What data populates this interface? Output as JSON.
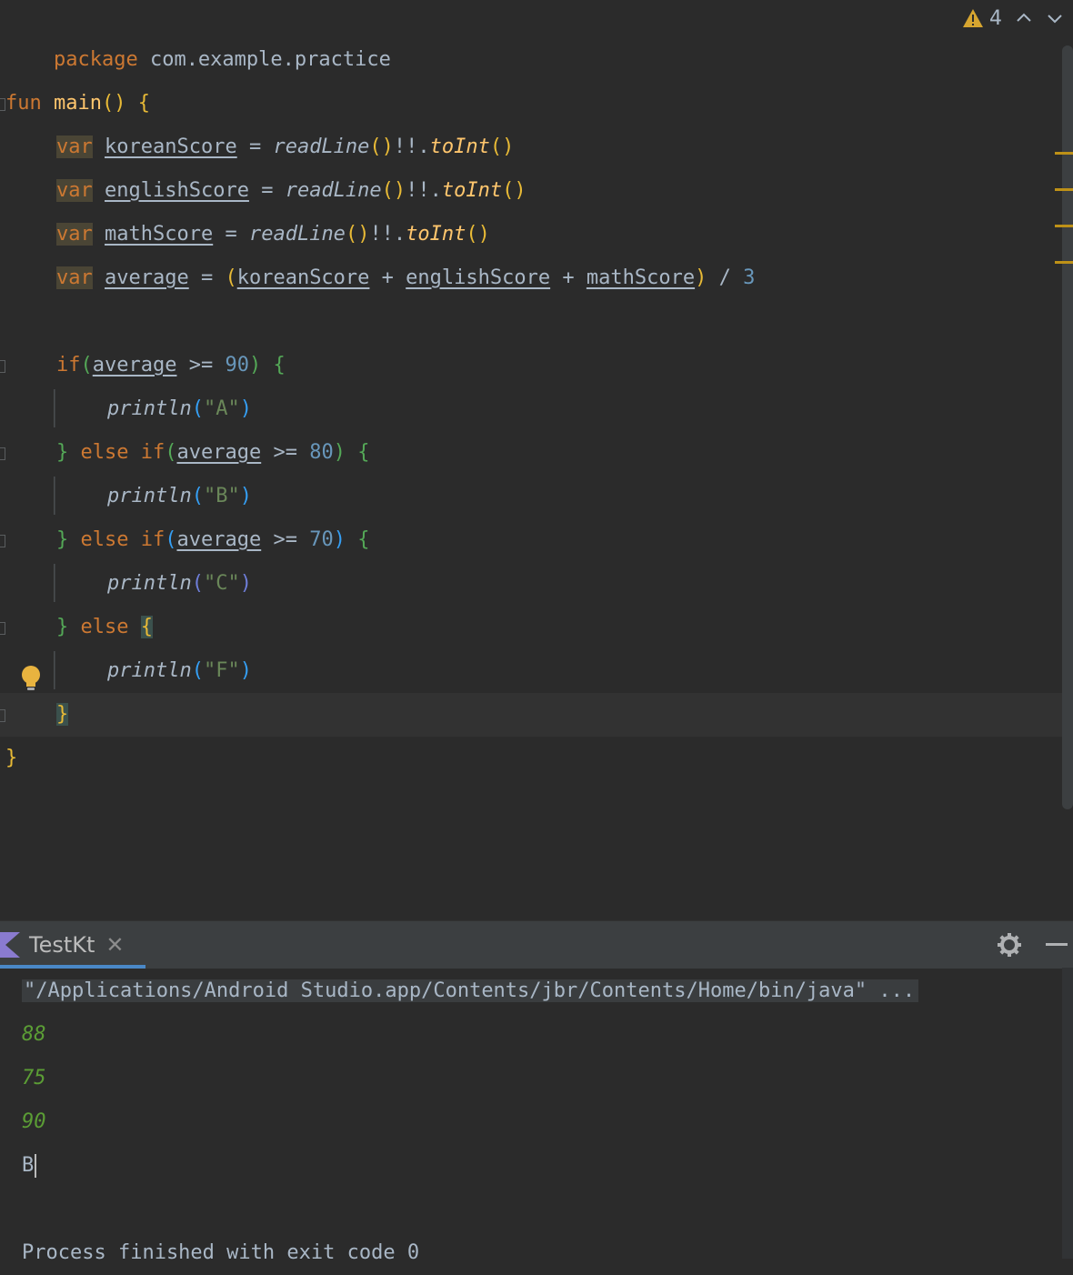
{
  "editor": {
    "package_line": {
      "keyword": "package",
      "name": "com.example.practice"
    },
    "warnings_count": "4",
    "code": {
      "fun_kw": "fun",
      "main_fn": "main",
      "paren_open": "(",
      "paren_close": ")",
      "brace_open": "{",
      "brace_close": "}",
      "var_kw": "var",
      "eq": "=",
      "read_line": "readLine",
      "not_null": "!!.",
      "to_int": "toInt",
      "korean": "koreanScore",
      "english": "englishScore",
      "math": "mathScore",
      "average": "average",
      "plus": "+",
      "div": "/",
      "three": "3",
      "if_kw": "if",
      "else_kw": "else",
      "gte": ">=",
      "n90": "90",
      "n80": "80",
      "n70": "70",
      "println": "println",
      "strA": "\"A\"",
      "strB": "\"B\"",
      "strC": "\"C\"",
      "strF": "\"F\""
    }
  },
  "run_panel": {
    "tab_label": "TestKt",
    "console": {
      "command": "\"/Applications/Android Studio.app/Contents/jbr/Contents/Home/bin/java\" ...",
      "inputs": [
        "88",
        "75",
        "90"
      ],
      "output": "B",
      "exit_message": "Process finished with exit code 0"
    }
  },
  "colors": {
    "background": "#2b2b2b",
    "keyword": "#cc7832",
    "function": "#ffc66d",
    "number": "#6897bb",
    "string": "#6a8759",
    "input_echo": "#5b9d35"
  }
}
